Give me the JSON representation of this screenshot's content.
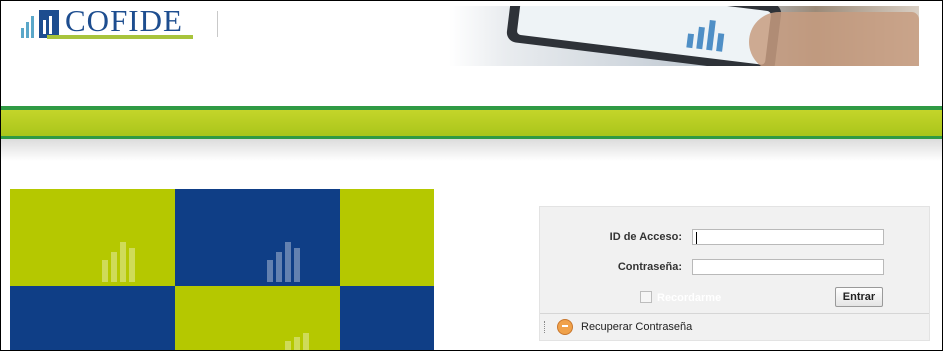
{
  "brand": {
    "logo_text": "COFIDE"
  },
  "login": {
    "id_label": "ID de Acceso:",
    "id_value": "",
    "password_label": "Contraseña:",
    "password_value": "",
    "remember_label": "Recordarme",
    "remember_checked": false,
    "submit_label": "Entrar",
    "recover_label": "Recuperar Contraseña"
  },
  "colors": {
    "brand_blue": "#1d4d8f",
    "brand_green": "#a8c43c",
    "band_green": "#2f9a44",
    "tile_green": "#b5c800",
    "tile_blue": "#0f3e86"
  }
}
